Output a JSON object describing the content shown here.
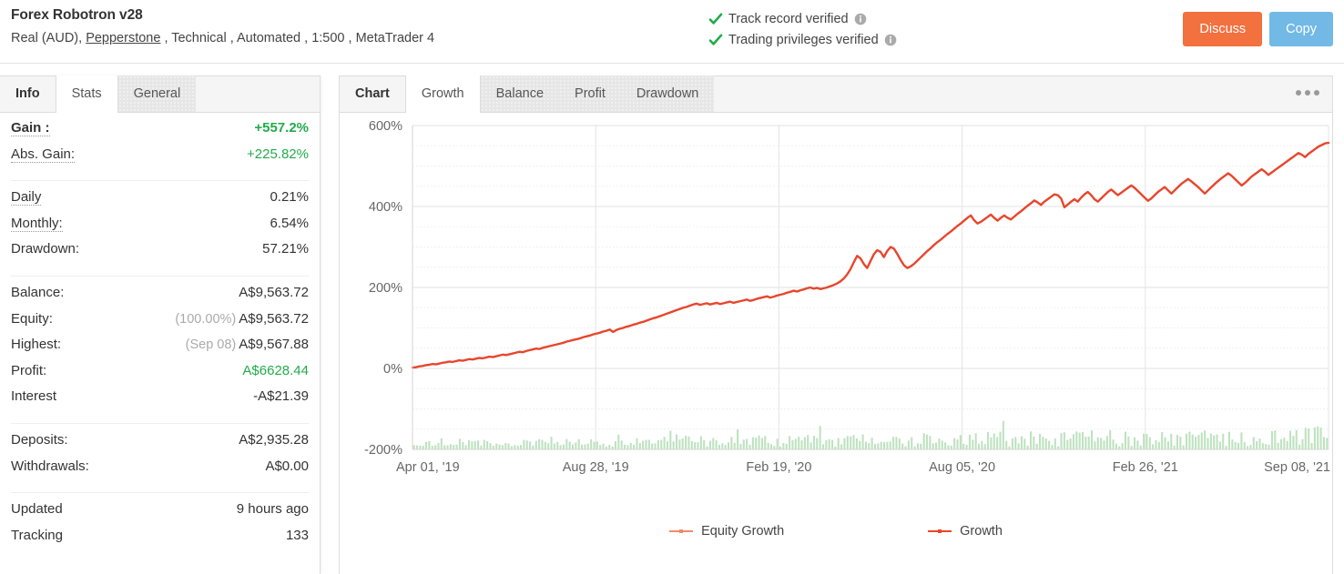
{
  "header": {
    "account_title": "Forex Robotron v28",
    "meta_prefix": "Real (AUD), ",
    "broker": "Pepperstone",
    "meta_suffix": " , Technical , Automated , 1:500 , MetaTrader 4",
    "verifications": [
      {
        "label": "Track record verified",
        "icon": "check-icon",
        "info_icon": "info-icon"
      },
      {
        "label": "Trading privileges verified",
        "icon": "check-icon",
        "info_icon": "info-icon"
      }
    ],
    "buttons": {
      "discuss": "Discuss",
      "copy": "Copy"
    },
    "colors": {
      "discuss_bg": "#f3703f",
      "copy_bg": "#72b9e5",
      "check_green": "#22ab4b"
    }
  },
  "sidebar": {
    "tabs": [
      {
        "label": "Info",
        "state": "plain"
      },
      {
        "label": "Stats",
        "state": "active"
      },
      {
        "label": "General",
        "state": "shaded"
      }
    ],
    "groups": [
      {
        "rows": [
          {
            "label": "Gain :",
            "value": "+557.2%",
            "label_style": "bold-dotted",
            "value_style": "green-bold"
          },
          {
            "label": "Abs. Gain:",
            "value": "+225.82%",
            "label_style": "dotted",
            "value_style": "green"
          }
        ]
      },
      {
        "rows": [
          {
            "label": "Daily",
            "value": "0.21%",
            "label_style": "dotted",
            "value_style": "plain"
          },
          {
            "label": "Monthly:",
            "value": "6.54%",
            "label_style": "dotted",
            "value_style": "plain"
          },
          {
            "label": "Drawdown:",
            "value": "57.21%",
            "label_style": "plain",
            "value_style": "plain"
          }
        ]
      },
      {
        "rows": [
          {
            "label": "Balance:",
            "value": "A$9,563.72",
            "label_style": "plain",
            "value_style": "plain"
          },
          {
            "label": "Equity:",
            "value": "A$9,563.72",
            "sub": "(100.00%)",
            "label_style": "plain",
            "value_style": "plain"
          },
          {
            "label": "Highest:",
            "value": "A$9,567.88",
            "sub": "(Sep 08)",
            "label_style": "plain",
            "value_style": "plain"
          },
          {
            "label": "Profit:",
            "value": "A$6628.44",
            "label_style": "plain",
            "value_style": "green"
          },
          {
            "label": "Interest",
            "value": "-A$21.39",
            "label_style": "plain",
            "value_style": "plain"
          }
        ]
      },
      {
        "rows": [
          {
            "label": "Deposits:",
            "value": "A$2,935.28",
            "label_style": "plain",
            "value_style": "plain"
          },
          {
            "label": "Withdrawals:",
            "value": "A$0.00",
            "label_style": "plain",
            "value_style": "plain"
          }
        ]
      },
      {
        "rows": [
          {
            "label": "Updated",
            "value": "9 hours ago",
            "label_style": "plain",
            "value_style": "plain"
          },
          {
            "label": "Tracking",
            "value": "133",
            "label_style": "plain",
            "value_style": "plain"
          }
        ]
      }
    ]
  },
  "chart_panel": {
    "tabs": [
      {
        "label": "Chart",
        "state": "plain"
      },
      {
        "label": "Growth",
        "state": "active"
      },
      {
        "label": "Balance",
        "state": "shaded"
      },
      {
        "label": "Profit",
        "state": "shaded"
      },
      {
        "label": "Drawdown",
        "state": "shaded"
      }
    ],
    "menu_icon": "ellipsis-icon"
  },
  "chart_data": {
    "type": "line",
    "title": "",
    "xlabel": "",
    "ylabel": "",
    "ylim": [
      -200,
      600
    ],
    "yticks": [
      "-200%",
      "0%",
      "200%",
      "400%",
      "600%"
    ],
    "ytick_values": [
      -200,
      0,
      200,
      400,
      600
    ],
    "grid": true,
    "xticks": [
      "Apr 01, '19",
      "Aug 28, '19",
      "Feb 19, '20",
      "Aug 05, '20",
      "Feb 26, '21",
      "Sep 08, '21"
    ],
    "legend_position": "bottom",
    "legend": [
      {
        "name": "Equity Growth",
        "color": "#f08b6b"
      },
      {
        "name": "Growth",
        "color": "#e8452c"
      }
    ],
    "series": [
      {
        "name": "Growth",
        "color": "#e8452c",
        "values": [
          2,
          3,
          5,
          6,
          8,
          9,
          11,
          10,
          12,
          14,
          15,
          17,
          16,
          18,
          20,
          19,
          21,
          23,
          22,
          24,
          26,
          25,
          27,
          29,
          28,
          30,
          32,
          34,
          33,
          35,
          37,
          39,
          41,
          40,
          43,
          45,
          47,
          49,
          48,
          51,
          53,
          55,
          57,
          59,
          61,
          63,
          66,
          68,
          70,
          72,
          74,
          77,
          79,
          81,
          84,
          86,
          88,
          91,
          93,
          96,
          90,
          95,
          98,
          100,
          103,
          105,
          108,
          110,
          113,
          115,
          118,
          121,
          124,
          126,
          129,
          132,
          135,
          138,
          141,
          144,
          147,
          150,
          152,
          155,
          158,
          160,
          157,
          159,
          161,
          158,
          160,
          162,
          159,
          161,
          163,
          165,
          162,
          164,
          166,
          168,
          170,
          167,
          169,
          172,
          174,
          176,
          178,
          175,
          177,
          180,
          182,
          184,
          187,
          189,
          192,
          190,
          193,
          195,
          198,
          200,
          197,
          199,
          196,
          198,
          200,
          203,
          206,
          210,
          215,
          222,
          232,
          245,
          262,
          278,
          272,
          258,
          248,
          265,
          282,
          292,
          288,
          275,
          290,
          300,
          296,
          283,
          268,
          255,
          248,
          252,
          258,
          266,
          274,
          282,
          290,
          297,
          305,
          312,
          318,
          325,
          332,
          338,
          345,
          352,
          358,
          365,
          372,
          378,
          366,
          358,
          362,
          368,
          374,
          380,
          372,
          365,
          372,
          378,
          372,
          368,
          375,
          382,
          388,
          395,
          402,
          408,
          415,
          410,
          404,
          412,
          418,
          424,
          430,
          428,
          420,
          398,
          405,
          412,
          418,
          412,
          422,
          430,
          436,
          428,
          418,
          412,
          420,
          428,
          436,
          442,
          435,
          428,
          434,
          440,
          446,
          452,
          446,
          438,
          430,
          422,
          414,
          420,
          428,
          436,
          442,
          448,
          440,
          432,
          440,
          448,
          456,
          462,
          468,
          462,
          455,
          448,
          440,
          432,
          440,
          448,
          456,
          463,
          470,
          476,
          482,
          476,
          468,
          460,
          452,
          458,
          466,
          474,
          480,
          486,
          492,
          486,
          478,
          484,
          490,
          496,
          502,
          508,
          514,
          520,
          526,
          532,
          528,
          522,
          530,
          536,
          542,
          548,
          552,
          556,
          557.2
        ]
      }
    ],
    "bars": {
      "name": "Equity Growth",
      "color": "#b7dfb9",
      "baseline": -200,
      "description": "small green volume bars rising from the -200% baseline, increasing toward the right"
    }
  }
}
